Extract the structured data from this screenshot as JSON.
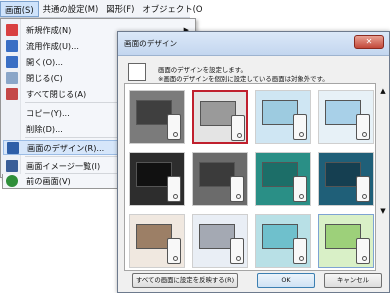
{
  "menubar": {
    "items": [
      "画面(S)",
      "共通の設定(M)",
      "図形(F)",
      "オブジェクト(O"
    ]
  },
  "menu": {
    "items": [
      {
        "label": "新規作成(N)",
        "icon": "new-screen-icon",
        "color": "#d84040",
        "submenu": true
      },
      {
        "label": "流用作成(U)...",
        "icon": "copy-create-icon",
        "color": "#3a6fc4"
      },
      {
        "label": "開く(O)...",
        "icon": "open-icon",
        "color": "#3a6fc4"
      },
      {
        "label": "閉じる(C)",
        "icon": "close-screen-icon",
        "color": "#8aa6c8"
      },
      {
        "label": "すべて閉じる(A)",
        "icon": "close-all-icon",
        "color": "#c44848"
      },
      {
        "label": "コピー(Y)...",
        "icon": "",
        "color": ""
      },
      {
        "label": "削除(D)...",
        "icon": "",
        "color": ""
      },
      {
        "label": "画面のデザイン(R)...",
        "icon": "screen-design-icon",
        "color": "#2e5fa8",
        "highlight": true
      },
      {
        "label": "画面イメージ一覧(I)",
        "icon": "screen-image-list-icon",
        "color": "#3a5e98"
      },
      {
        "label": "前の画面(V)",
        "icon": "back-icon",
        "color": "#2f8f3a"
      }
    ]
  },
  "dialog": {
    "title": "画面のデザイン",
    "close_label": "✕",
    "message_line1": "画面のデザインを設定します。",
    "message_line2": "※画面のデザインを個別に設定している画面は対象外です。",
    "apply_all_button": "すべての画面に設定を反映する(R)",
    "ok_button": "OK",
    "cancel_button": "キャンセル",
    "tiles": [
      {
        "bg": "#7b7b7b",
        "win": "#3f3f3f",
        "selected": false
      },
      {
        "bg": "#e4e4e4",
        "win": "#9a9a9a",
        "selected": true
      },
      {
        "bg": "#cfe6f3",
        "win": "#9dcbe0",
        "selected": false
      },
      {
        "bg": "#e7f1f7",
        "win": "#a8d0e8",
        "selected": false
      },
      {
        "bg": "#2d2d2d",
        "win": "#111111",
        "selected": false
      },
      {
        "bg": "#6b6b6b",
        "win": "#3b3b3b",
        "selected": false
      },
      {
        "bg": "#2a8f86",
        "win": "#1c6e68",
        "selected": false
      },
      {
        "bg": "#1f5f78",
        "win": "#153f51",
        "selected": false
      },
      {
        "bg": "#f0e8e0",
        "win": "#9c7f66",
        "selected": false
      },
      {
        "bg": "#e9eef5",
        "win": "#a4a9b3",
        "selected": false
      },
      {
        "bg": "#b8e0e6",
        "win": "#6fc0cc",
        "selected": false
      },
      {
        "bg": "#d9f0c7",
        "win": "#9dd07a",
        "selected": false,
        "light_selected": true
      }
    ]
  }
}
